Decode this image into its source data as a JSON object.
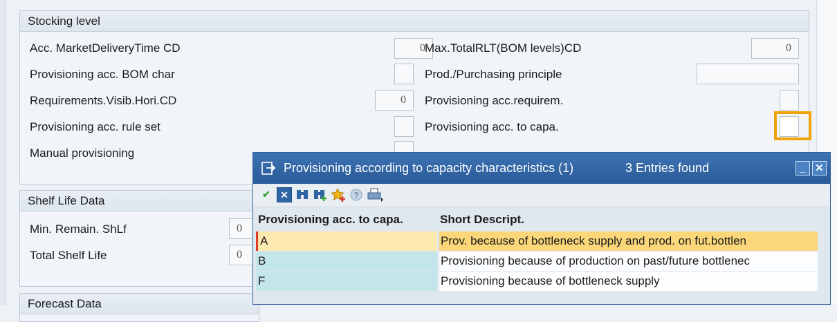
{
  "stocking": {
    "title": "Stocking level",
    "left": [
      {
        "label": "Acc. MarketDeliveryTime CD",
        "value": "0"
      },
      {
        "label": "Provisioning acc. BOM char",
        "value": ""
      },
      {
        "label": "Requirements.Visib.Hori.CD",
        "value": "0"
      },
      {
        "label": "Provisioning acc. rule set",
        "value": ""
      },
      {
        "label": "Manual provisioning",
        "value": ""
      }
    ],
    "right": [
      {
        "label": "Max.TotalRLT(BOM levels)CD",
        "value": "0"
      },
      {
        "label": "Prod./Purchasing principle",
        "value": ""
      },
      {
        "label": "Provisioning acc.requirem.",
        "value": ""
      },
      {
        "label": "Provisioning acc. to capa.",
        "value": ""
      }
    ]
  },
  "shelf": {
    "title": "Shelf Life Data",
    "fields": [
      {
        "label": "Min. Remain. ShLf",
        "value": "0"
      },
      {
        "label": "Total Shelf Life",
        "value": "0"
      }
    ]
  },
  "forecast": {
    "title": "Forecast Data"
  },
  "popup": {
    "title": "Provisioning according to capacity characteristics (1)",
    "count": "3 Entries found",
    "columns": [
      "Provisioning acc. to capa.",
      "Short Descript."
    ],
    "rows": [
      {
        "code": "A",
        "desc": "Prov. because of bottleneck supply and prod. on fut.bottlen"
      },
      {
        "code": "B",
        "desc": "Provisioning because of production on past/future bottlenec"
      },
      {
        "code": "F",
        "desc": "Provisioning because of bottleneck supply"
      }
    ],
    "toolbar_icons": [
      "continue-icon",
      "cancel-icon",
      "find-icon",
      "find-next-icon",
      "add-favorite-icon",
      "help-icon",
      "print-icon"
    ]
  },
  "colors": {
    "accent": "#f0a30a",
    "titlebar": "#2f64a5",
    "selected_row": "#fbd779",
    "row_key": "#c2e6ea"
  }
}
